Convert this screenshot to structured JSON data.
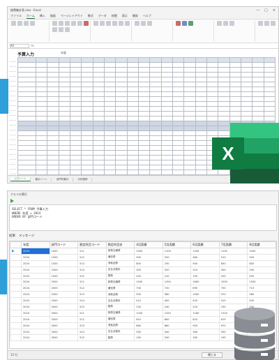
{
  "excel": {
    "file_name": "経費集計表.xlsx - Excel",
    "window_controls": [
      "—",
      "□",
      "×"
    ],
    "ribbon_tabs": [
      "ファイル",
      "ホーム",
      "挿入",
      "描画",
      "ページレイアウト",
      "数式",
      "データ",
      "校閲",
      "表示",
      "開発",
      "ヘルプ"
    ],
    "active_tab": "ホーム",
    "name_box": "A1",
    "fx": "fx",
    "sheet_title": "予算入力",
    "sheet_subtitle": "年度",
    "sheet_tabs": [
      "入力シート",
      "集計シート",
      "部門別集計",
      "月別推移"
    ],
    "logo_letter": "X",
    "colors": {
      "excel_green": "#107c41",
      "accent_blue": "#2e9fd8"
    }
  },
  "sql": {
    "window_title": "クエリの実行",
    "editor_lines": [
      "SELECT * FROM 予算入力",
      "WHERE 年度 = 2024",
      "ORDER BY 部門コード"
    ],
    "result_tabs": [
      "結果",
      "メッセージ"
    ],
    "columns": [
      "年度",
      "部門コード",
      "勘定科目コード",
      "勘定科目名",
      "4月実績",
      "5月実績",
      "6月実績",
      "7月実績",
      "8月実績"
    ],
    "rows": [
      [
        "2024",
        "1000",
        "511",
        "旅費交通費",
        "1000",
        "1100",
        "1200",
        "1100",
        "1000"
      ],
      [
        "2024",
        "1000",
        "512",
        "通信費",
        "500",
        "520",
        "480",
        "510",
        "500"
      ],
      [
        "2024",
        "1000",
        "513",
        "消耗品費",
        "800",
        "750",
        "900",
        "850",
        "800"
      ],
      [
        "2024",
        "1000",
        "514",
        "支払手数料",
        "300",
        "320",
        "310",
        "300",
        "290"
      ],
      [
        "2024",
        "1000",
        "515",
        "雑費",
        "200",
        "210",
        "190",
        "200",
        "205"
      ],
      [
        "2024",
        "2000",
        "511",
        "旅費交通費",
        "1500",
        "1450",
        "1600",
        "1550",
        "1500"
      ],
      [
        "2024",
        "2000",
        "512",
        "通信費",
        "700",
        "720",
        "690",
        "700",
        "710"
      ],
      [
        "2024",
        "2000",
        "513",
        "消耗品費",
        "950",
        "980",
        "1000",
        "970",
        "960"
      ],
      [
        "2024",
        "2000",
        "514",
        "支払手数料",
        "410",
        "400",
        "420",
        "415",
        "405"
      ],
      [
        "2024",
        "2000",
        "515",
        "雑費",
        "230",
        "240",
        "220",
        "235",
        "230"
      ],
      [
        "2024",
        "3000",
        "511",
        "旅費交通費",
        "1200",
        "1250",
        "1180",
        "1220",
        "1210"
      ],
      [
        "2024",
        "3000",
        "512",
        "通信費",
        "610",
        "600",
        "620",
        "615",
        "605"
      ],
      [
        "2024",
        "3000",
        "513",
        "消耗品費",
        "880",
        "860",
        "900",
        "870",
        "875"
      ],
      [
        "2024",
        "3000",
        "514",
        "支払手数料",
        "350",
        "340",
        "360",
        "355",
        "345"
      ],
      [
        "2024",
        "3000",
        "515",
        "雑費",
        "190",
        "200",
        "185",
        "195",
        "190"
      ]
    ],
    "status_text": "15 行",
    "close_button": "閉じる"
  }
}
